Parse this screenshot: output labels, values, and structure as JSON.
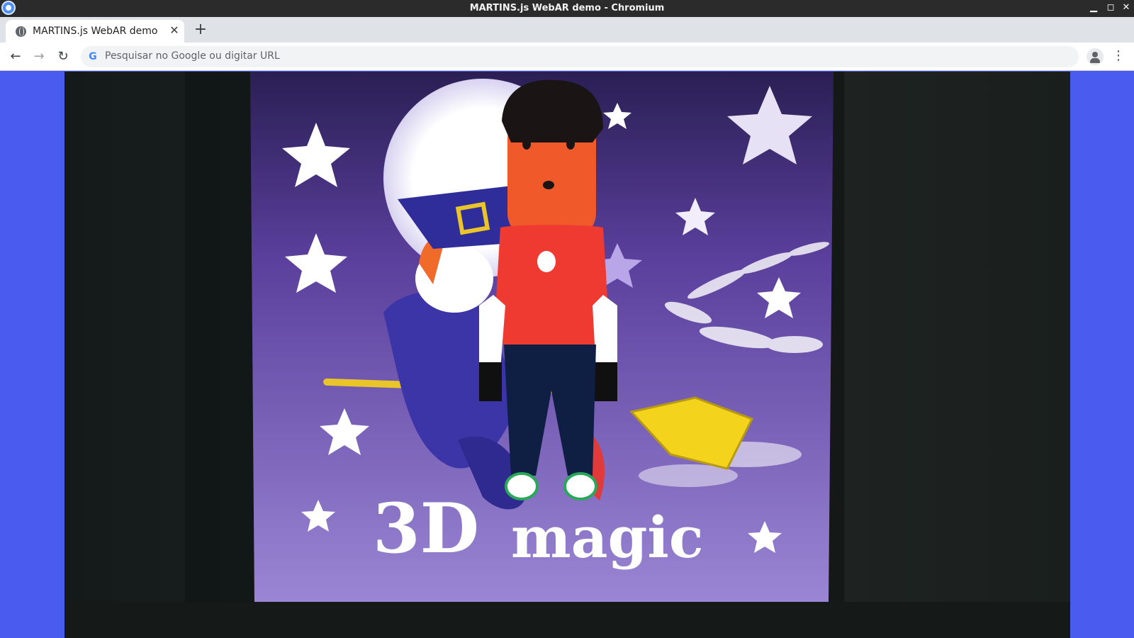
{
  "window": {
    "title": "MARTINS.js WebAR demo - Chromium",
    "controls": {
      "minimize": "▁",
      "maximize": "◻",
      "close": "✕"
    }
  },
  "tabs": [
    {
      "label": "MARTINS.js WebAR demo",
      "close": "✕",
      "active": true
    }
  ],
  "tabstrip": {
    "new_tab": "+"
  },
  "toolbar": {
    "back": "←",
    "forward": "→",
    "reload": "↻",
    "omnibox": {
      "placeholder": "Pesquisar no Google ou digitar URL",
      "engine_icon": "G"
    },
    "menu": "⋮"
  },
  "scene": {
    "poster_text_left": "3D",
    "poster_text_right": "magic",
    "colors": {
      "page_background": "#4a5cf0",
      "poster_purple": "#8a72cc",
      "character_skin": "#f05a2a",
      "character_shirt": "#ef3a32",
      "character_pants": "#0f1f44",
      "broom_yellow": "#f4d31c"
    }
  }
}
